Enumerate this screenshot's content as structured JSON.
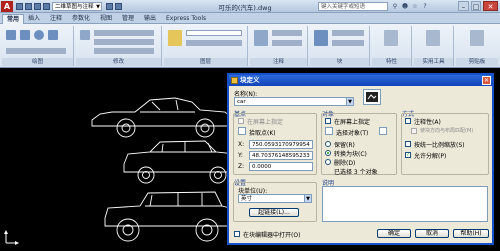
{
  "titlebar": {
    "app_logo": "A",
    "workspace": "二维草图与注释",
    "title": "可乐的(汽车).dwg",
    "search_placeholder": "键入关键字或短语",
    "icons": [
      "new-icon",
      "open-icon",
      "save-icon",
      "undo-icon",
      "redo-icon",
      "print-icon"
    ]
  },
  "ribbon": {
    "tabs": [
      "常用",
      "插入",
      "注释",
      "参数化",
      "视图",
      "管理",
      "输出",
      "Express Tools"
    ],
    "groups": [
      "绘图",
      "修改",
      "图层",
      "注释",
      "块",
      "特性",
      "实用工具",
      "剪贴板"
    ]
  },
  "dialog": {
    "title": "块定义",
    "name_label": "名称(N):",
    "name_value": "car",
    "base_point": {
      "header": "基点",
      "onscreen": "在屏幕上指定",
      "pick_button": "拾取点(K)",
      "x": "750.0593170979954",
      "y": "48.70376148595233",
      "z": "0.0000"
    },
    "objects": {
      "header": "对象",
      "onscreen": "在屏幕上指定",
      "select_button": "选择对象(T)",
      "retain": "保留(R)",
      "convert": "转换为块(C)",
      "delete": "删除(D)",
      "selected": "已选择 3 个对象"
    },
    "behavior": {
      "header": "方式",
      "annotative": "注释性(A)",
      "match_orientation": "使块方向与布局匹配(M)",
      "scale_uniformly": "按统一比例缩放(S)",
      "allow_explode": "允许分解(P)"
    },
    "settings": {
      "header": "设置",
      "unit_label": "块单位(U):",
      "unit_value": "英寸",
      "hyperlink_button": "超链接(L)..."
    },
    "description_label": "说明",
    "open_in_editor": "在块编辑器中打开(O)",
    "ok": "确定",
    "cancel": "取消",
    "help": "帮助(H)"
  },
  "colors": {
    "dialog_title": "#1751c9",
    "drawing_bg": "#000000",
    "checkmark": "#21a121"
  }
}
